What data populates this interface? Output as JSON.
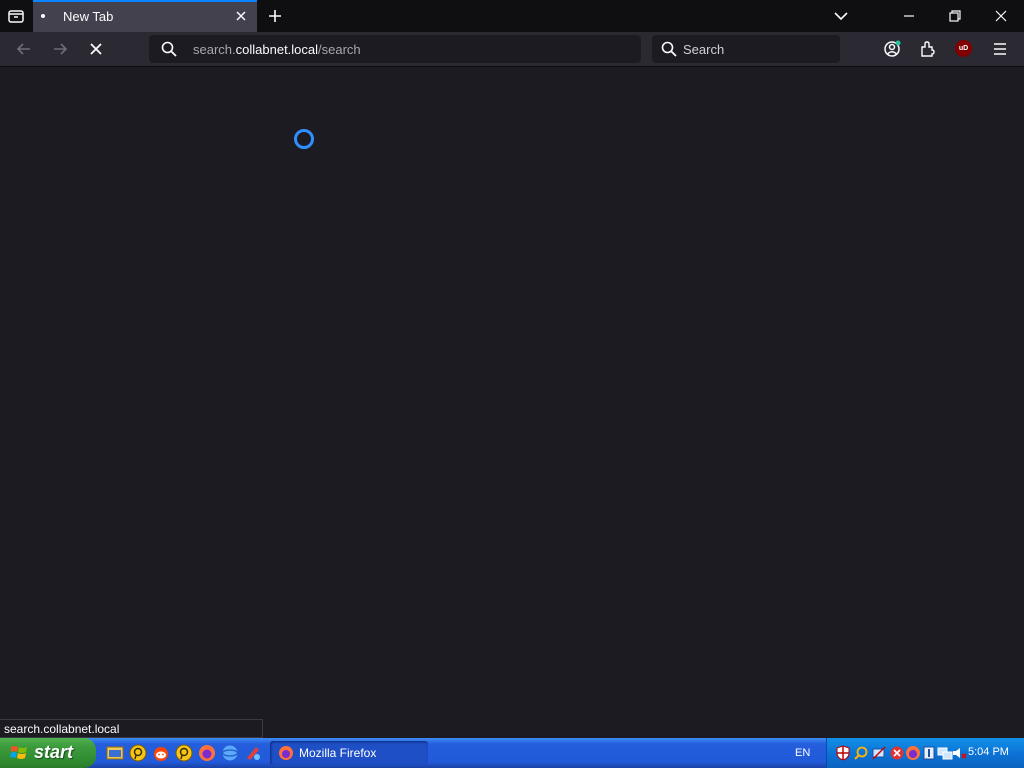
{
  "browser": {
    "tab": {
      "title": "New Tab"
    },
    "url": {
      "prefix": "search.",
      "host": "collabnet.local",
      "path": "/search"
    },
    "search": {
      "placeholder": "Search"
    },
    "ublock_badge": "uD",
    "status_text": "search.collabnet.local"
  },
  "taskbar": {
    "start_label": "start",
    "task": {
      "label": "Mozilla Firefox"
    },
    "language": "EN",
    "clock": "5:04 PM"
  },
  "colors": {
    "accent": "#0a84ff",
    "content_bg": "#1c1b22",
    "toolbar_bg": "#2b2a33",
    "spinner": "#2f8fff"
  }
}
